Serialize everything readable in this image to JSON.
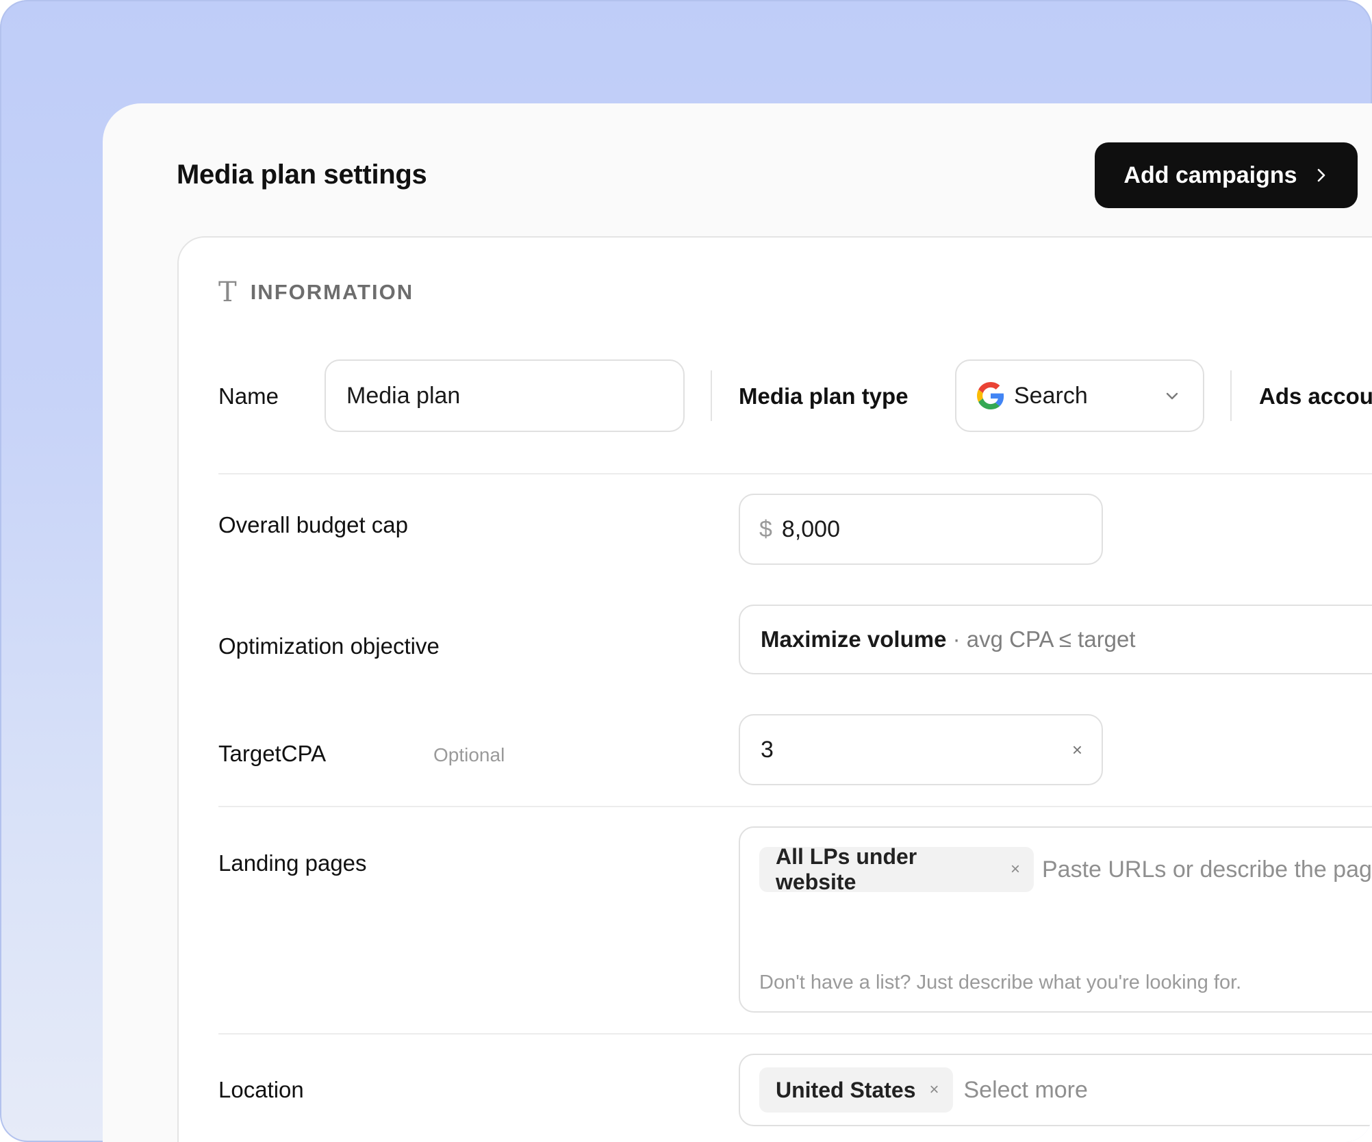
{
  "header": {
    "title": "Media plan settings",
    "add_campaigns_label": "Add campaigns"
  },
  "section": {
    "icon": "text-type-icon",
    "title": "INFORMATION"
  },
  "name_row": {
    "name_label": "Name",
    "name_value": "Media plan",
    "type_label": "Media plan type",
    "type_value": "Search",
    "ads_label": "Ads accou"
  },
  "budget": {
    "label": "Overall budget cap",
    "currency": "$",
    "value": "8,000"
  },
  "objective": {
    "label": "Optimization objective",
    "value_bold": "Maximize volume",
    "value_rest": " · avg CPA ≤ target"
  },
  "target_cpa": {
    "label": "TargetCPA",
    "optional": "Optional",
    "value": "3",
    "clear": "×"
  },
  "landing_pages": {
    "label": "Landing pages",
    "chip": "All LPs under website",
    "chip_x": "×",
    "placeholder": "Paste URLs or describe the pages you wa",
    "hint": "Don't have a list? Just describe what you're looking for."
  },
  "location": {
    "label": "Location",
    "chip": "United States",
    "chip_x": "×",
    "placeholder": "Select more"
  },
  "colors": {
    "background": "#bfcdf8",
    "button": "#0f0f0f",
    "panel": "#fafafa"
  }
}
